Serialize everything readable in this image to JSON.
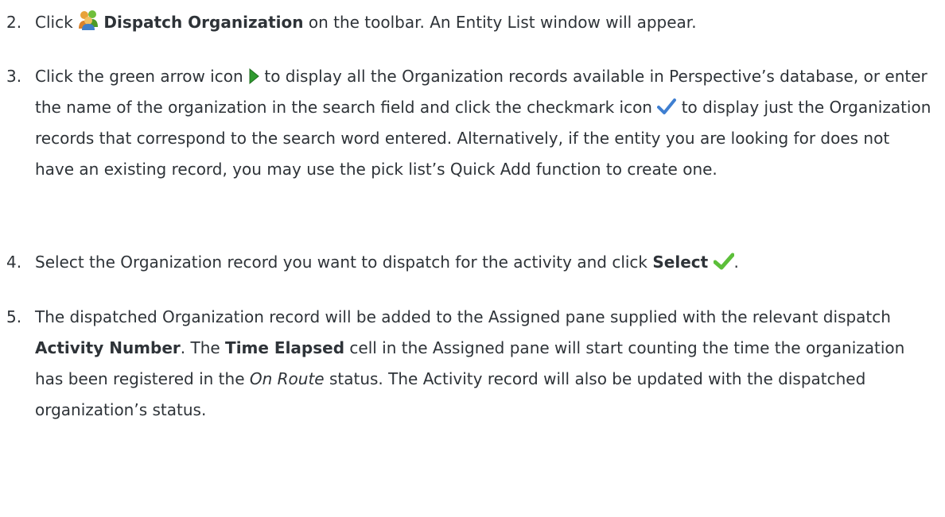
{
  "steps": [
    {
      "number": "2.",
      "parts": [
        {
          "t": "Click "
        },
        {
          "icon": "dispatch-organization-icon"
        },
        {
          "t": " "
        },
        {
          "b": "Dispatch Organization"
        },
        {
          "t": " on the toolbar. An Entity List window will appear."
        }
      ]
    },
    {
      "number": "3.",
      "parts": [
        {
          "t": "Click the green arrow icon "
        },
        {
          "icon": "green-arrow-icon"
        },
        {
          "t": " to display all the Organization records available in Perspective’s database, or enter the name of the organization in the search field and click the checkmark icon "
        },
        {
          "icon": "checkmark-icon"
        },
        {
          "t": " to display just the Organization records that correspond to the search word entered. Alternatively, if the entity you are looking for does not have an existing record, you may use the pick list’s Quick Add function to create one."
        }
      ]
    },
    {
      "number": "4.",
      "parts": [
        {
          "t": "Select the Organization record you want to dispatch for the activity and click "
        },
        {
          "b": "Select"
        },
        {
          "t": " "
        },
        {
          "icon": "select-checkmark-icon"
        },
        {
          "t": "."
        }
      ]
    },
    {
      "number": "5.",
      "parts": [
        {
          "t": "The dispatched Organization record will be added to the Assigned pane supplied with the relevant dispatch "
        },
        {
          "b": "Activity Number"
        },
        {
          "t": ". The "
        },
        {
          "b": "Time Elapsed"
        },
        {
          "t": " cell in the Assigned pane will start counting the time the organization has been registered in the "
        },
        {
          "i": "On Route"
        },
        {
          "t": " status. The Activity record will also be updated with the dispatched organization’s status."
        }
      ]
    }
  ]
}
